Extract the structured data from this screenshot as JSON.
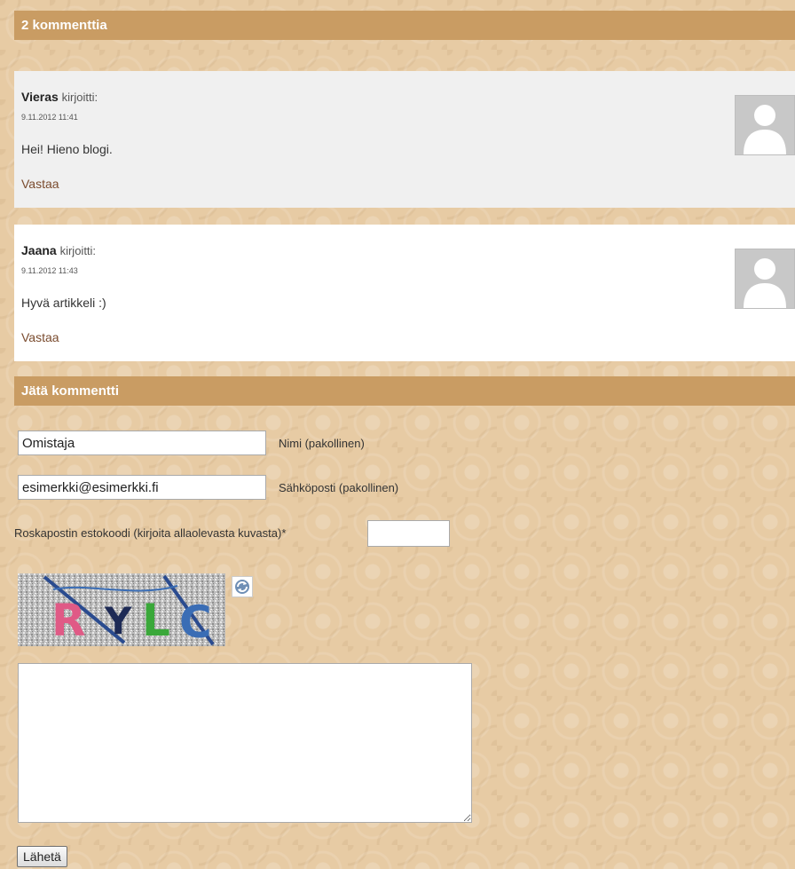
{
  "comments_section": {
    "heading": "2 kommenttia",
    "comments": [
      {
        "author": "Vieras",
        "wrote": "kirjoitti:",
        "date": "9.11.2012 11:41",
        "text": "Hei! Hieno blogi.",
        "reply": "Vastaa"
      },
      {
        "author": "Jaana",
        "wrote": "kirjoitti:",
        "date": "9.11.2012 11:43",
        "text": "Hyvä artikkeli :)",
        "reply": "Vastaa"
      }
    ]
  },
  "form": {
    "heading": "Jätä kommentti",
    "name_value": "Omistaja",
    "name_label": "Nimi (pakollinen)",
    "email_value": "esimerkki@esimerkki.fi",
    "email_label": "Sähköposti (pakollinen)",
    "captcha_label": "Roskapostin estokoodi (kirjoita allaolevasta kuvasta)*",
    "captcha_value": "",
    "captcha_text": "RYLC",
    "message_value": "",
    "submit_label": "Lähetä"
  },
  "colors": {
    "header_bar": "#c99c63",
    "reply_link": "#7a4b2e",
    "page_background": "#e7cba4"
  },
  "icons": {
    "avatar": "default-avatar-icon",
    "refresh": "refresh-captcha-icon"
  }
}
